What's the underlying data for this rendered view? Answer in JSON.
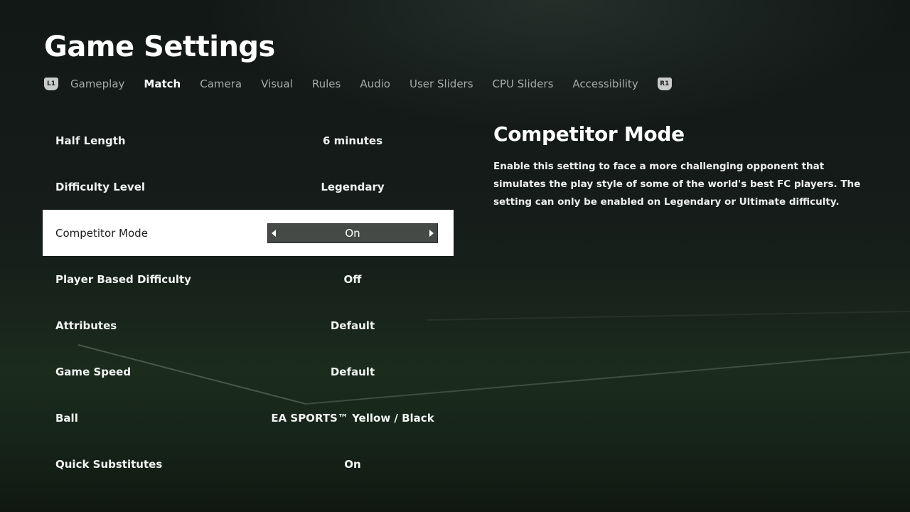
{
  "header": {
    "title": "Game Settings"
  },
  "tabs": {
    "left_hint": "L1",
    "right_hint": "R1",
    "items": [
      {
        "label": "Gameplay"
      },
      {
        "label": "Match"
      },
      {
        "label": "Camera"
      },
      {
        "label": "Visual"
      },
      {
        "label": "Rules"
      },
      {
        "label": "Audio"
      },
      {
        "label": "User Sliders"
      },
      {
        "label": "CPU Sliders"
      },
      {
        "label": "Accessibility"
      }
    ],
    "active": "Match"
  },
  "settings": [
    {
      "label": "Half Length",
      "value": "6 minutes"
    },
    {
      "label": "Difficulty Level",
      "value": "Legendary"
    },
    {
      "label": "Competitor Mode",
      "value": "On"
    },
    {
      "label": "Player Based Difficulty",
      "value": "Off"
    },
    {
      "label": "Attributes",
      "value": "Default"
    },
    {
      "label": "Game Speed",
      "value": "Default"
    },
    {
      "label": "Ball",
      "value": "EA SPORTS™ Yellow / Black"
    },
    {
      "label": "Quick Substitutes",
      "value": "On"
    }
  ],
  "selected_setting": "Competitor Mode",
  "description": {
    "title": "Competitor Mode",
    "text": "Enable this setting to face a more challenging opponent that simulates the play style of some of the world's best FC players. The setting can only be enabled on Legendary or Ultimate difficulty."
  },
  "colors": {
    "selected_row_bg": "#ffffff",
    "selector_bg": "#454a47",
    "inactive_tab": "#a6aba9"
  }
}
